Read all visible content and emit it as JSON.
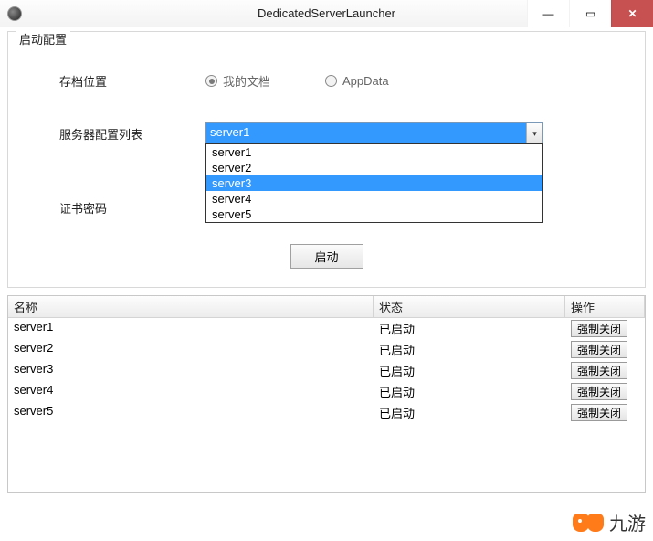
{
  "window": {
    "title": "DedicatedServerLauncher"
  },
  "group": {
    "legend": "启动配置",
    "save_location_label": "存档位置",
    "radio_mydocs": "我的文档",
    "radio_appdata": "AppData",
    "server_list_label": "服务器配置列表",
    "cert_pwd_label": "证书密码",
    "combo_value": "server1",
    "dropdown": [
      "server1",
      "server2",
      "server3",
      "server4",
      "server5"
    ],
    "dropdown_highlight_index": 2,
    "launch_btn": "启动"
  },
  "grid": {
    "headers": {
      "name": "名称",
      "status": "状态",
      "op": "操作"
    },
    "op_btn": "强制关闭",
    "rows": [
      {
        "name": "server1",
        "status": "已启动"
      },
      {
        "name": "server2",
        "status": "已启动"
      },
      {
        "name": "server3",
        "status": "已启动"
      },
      {
        "name": "server4",
        "status": "已启动"
      },
      {
        "name": "server5",
        "status": "已启动"
      }
    ]
  },
  "watermark": "九游"
}
